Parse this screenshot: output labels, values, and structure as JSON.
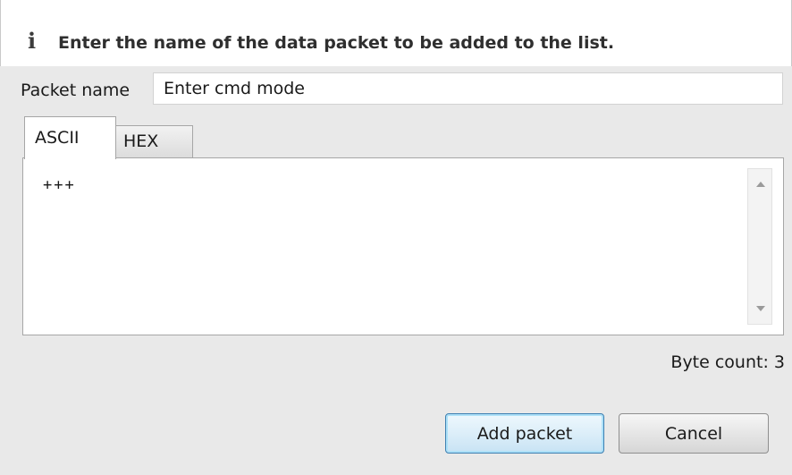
{
  "header": {
    "icon": "info-icon",
    "icon_glyph": "i",
    "message": "Enter the name of the data packet to be added to the list."
  },
  "packet_name": {
    "label": "Packet name",
    "value": "Enter cmd mode"
  },
  "tabs": [
    {
      "label": "ASCII",
      "selected": true
    },
    {
      "label": "HEX",
      "selected": false
    }
  ],
  "editor": {
    "content": "+++"
  },
  "byte_count_text": "Byte count: 3",
  "buttons": {
    "add": "Add packet",
    "cancel": "Cancel"
  },
  "colors": {
    "default_button_border": "#3c7fb1",
    "default_button_glow": "#aee1f8",
    "dialog_background": "#e9e9e9"
  }
}
